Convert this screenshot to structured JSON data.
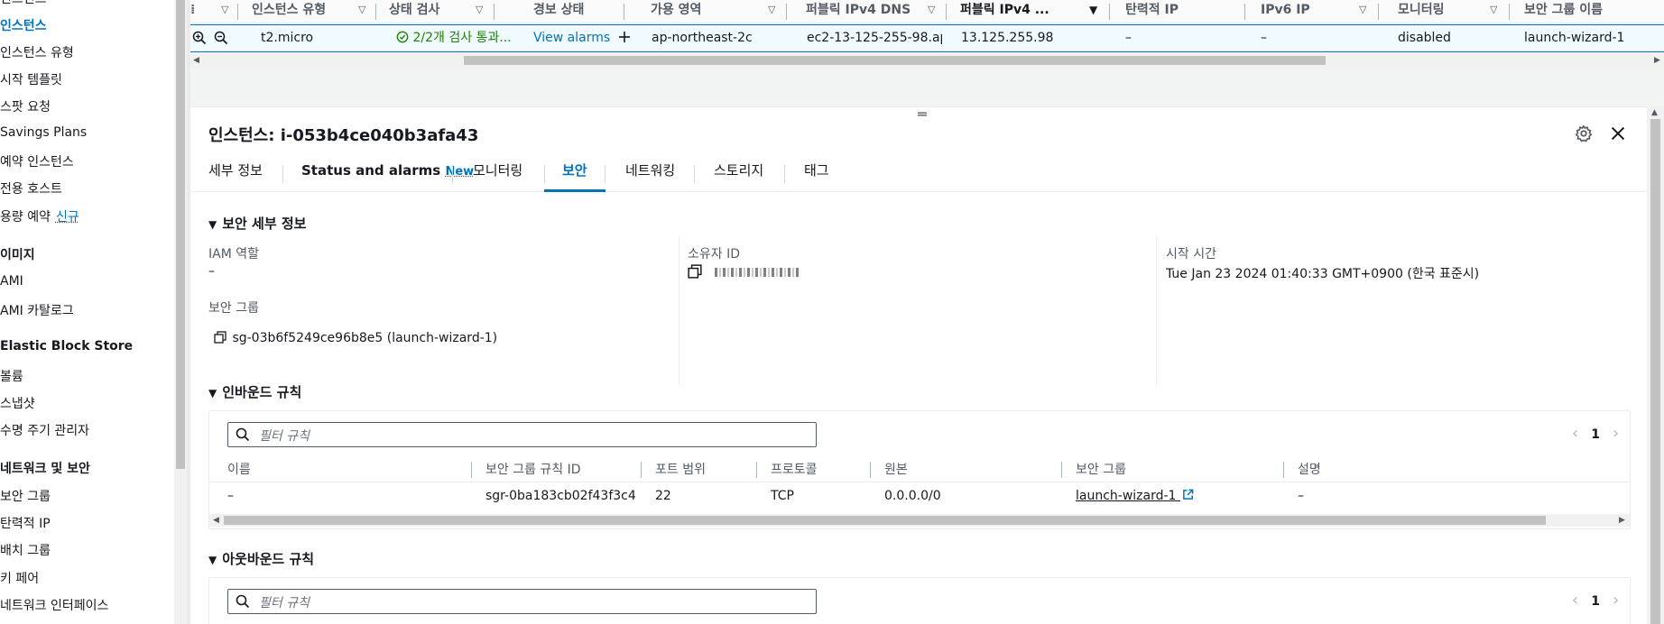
{
  "nav": {
    "cutoff": "인스턴스",
    "items": [
      {
        "label": "인스턴스",
        "active": true
      },
      {
        "label": "인스턴스 유형"
      },
      {
        "label": "시작 템플릿"
      },
      {
        "label": "스팟 요청"
      },
      {
        "label": "Savings Plans"
      },
      {
        "label": "예약 인스턴스"
      },
      {
        "label": "전용 호스트"
      },
      {
        "label": "용량 예약",
        "badge": "신규"
      }
    ],
    "images_head": "이미지",
    "images": [
      "AMI",
      "AMI 카탈로그"
    ],
    "ebs_head": "Elastic Block Store",
    "ebs": [
      "볼륨",
      "스냅샷",
      "수명 주기 관리자"
    ],
    "netsec_head": "네트워크 및 보안",
    "netsec": [
      "보안 그룹",
      "탄력적 IP",
      "배치 그룹",
      "키 페어",
      "네트워크 인터페이스"
    ]
  },
  "instances_table": {
    "headers": [
      "인스턴스 유형",
      "상태 검사",
      "경보 상태",
      "가용 영역",
      "퍼블릭 IPv4 DNS",
      "퍼블릭 IPv4 ...",
      "탄력적 IP",
      "IPv6 IP",
      "모니터링",
      "보안 그룹 이름"
    ],
    "row": {
      "type": "t2.micro",
      "status_check": "2/2개 검사 통과...",
      "alarm": "View alarms",
      "az": "ap-northeast-2c",
      "public_dns": "ec2-13-125-255-98.ap-...",
      "public_ipv4": "13.125.255.98",
      "elastic_ip": "–",
      "ipv6": "–",
      "monitoring": "disabled",
      "sg_name": "launch-wizard-1"
    }
  },
  "panel": {
    "title": "인스턴스: i-053b4ce040b3afa43",
    "tabs": [
      "세부 정보",
      "Status and alarms",
      "모니터링",
      "보안",
      "네트워킹",
      "스토리지",
      "태그"
    ],
    "tab_new": "New",
    "active_tab": "보안",
    "security_details": {
      "heading": "보안 세부 정보",
      "iam_label": "IAM 역할",
      "iam_value": "–",
      "owner_label": "소유자 ID",
      "launch_label": "시작 시간",
      "launch_value": "Tue Jan 23 2024 01:40:33 GMT+0900 (한국 표준시)",
      "sg_label": "보안 그룹",
      "sg_value": "sg-03b6f5249ce96b8e5 (launch-wizard-1)"
    },
    "inbound": {
      "heading": "인바운드 규칙",
      "filter_placeholder": "필터 규칙",
      "page": "1",
      "columns": [
        "이름",
        "보안 그룹 규칙 ID",
        "포트 범위",
        "프로토콜",
        "원본",
        "보안 그룹",
        "설명"
      ],
      "rows": [
        {
          "name": "–",
          "rule_id": "sgr-0ba183cb02f43f3c4",
          "port": "22",
          "protocol": "TCP",
          "source": "0.0.0.0/0",
          "sg": "launch-wizard-1",
          "desc": "–"
        }
      ]
    },
    "outbound": {
      "heading": "아웃바운드 규칙",
      "filter_placeholder": "필터 규칙",
      "page": "1"
    }
  }
}
